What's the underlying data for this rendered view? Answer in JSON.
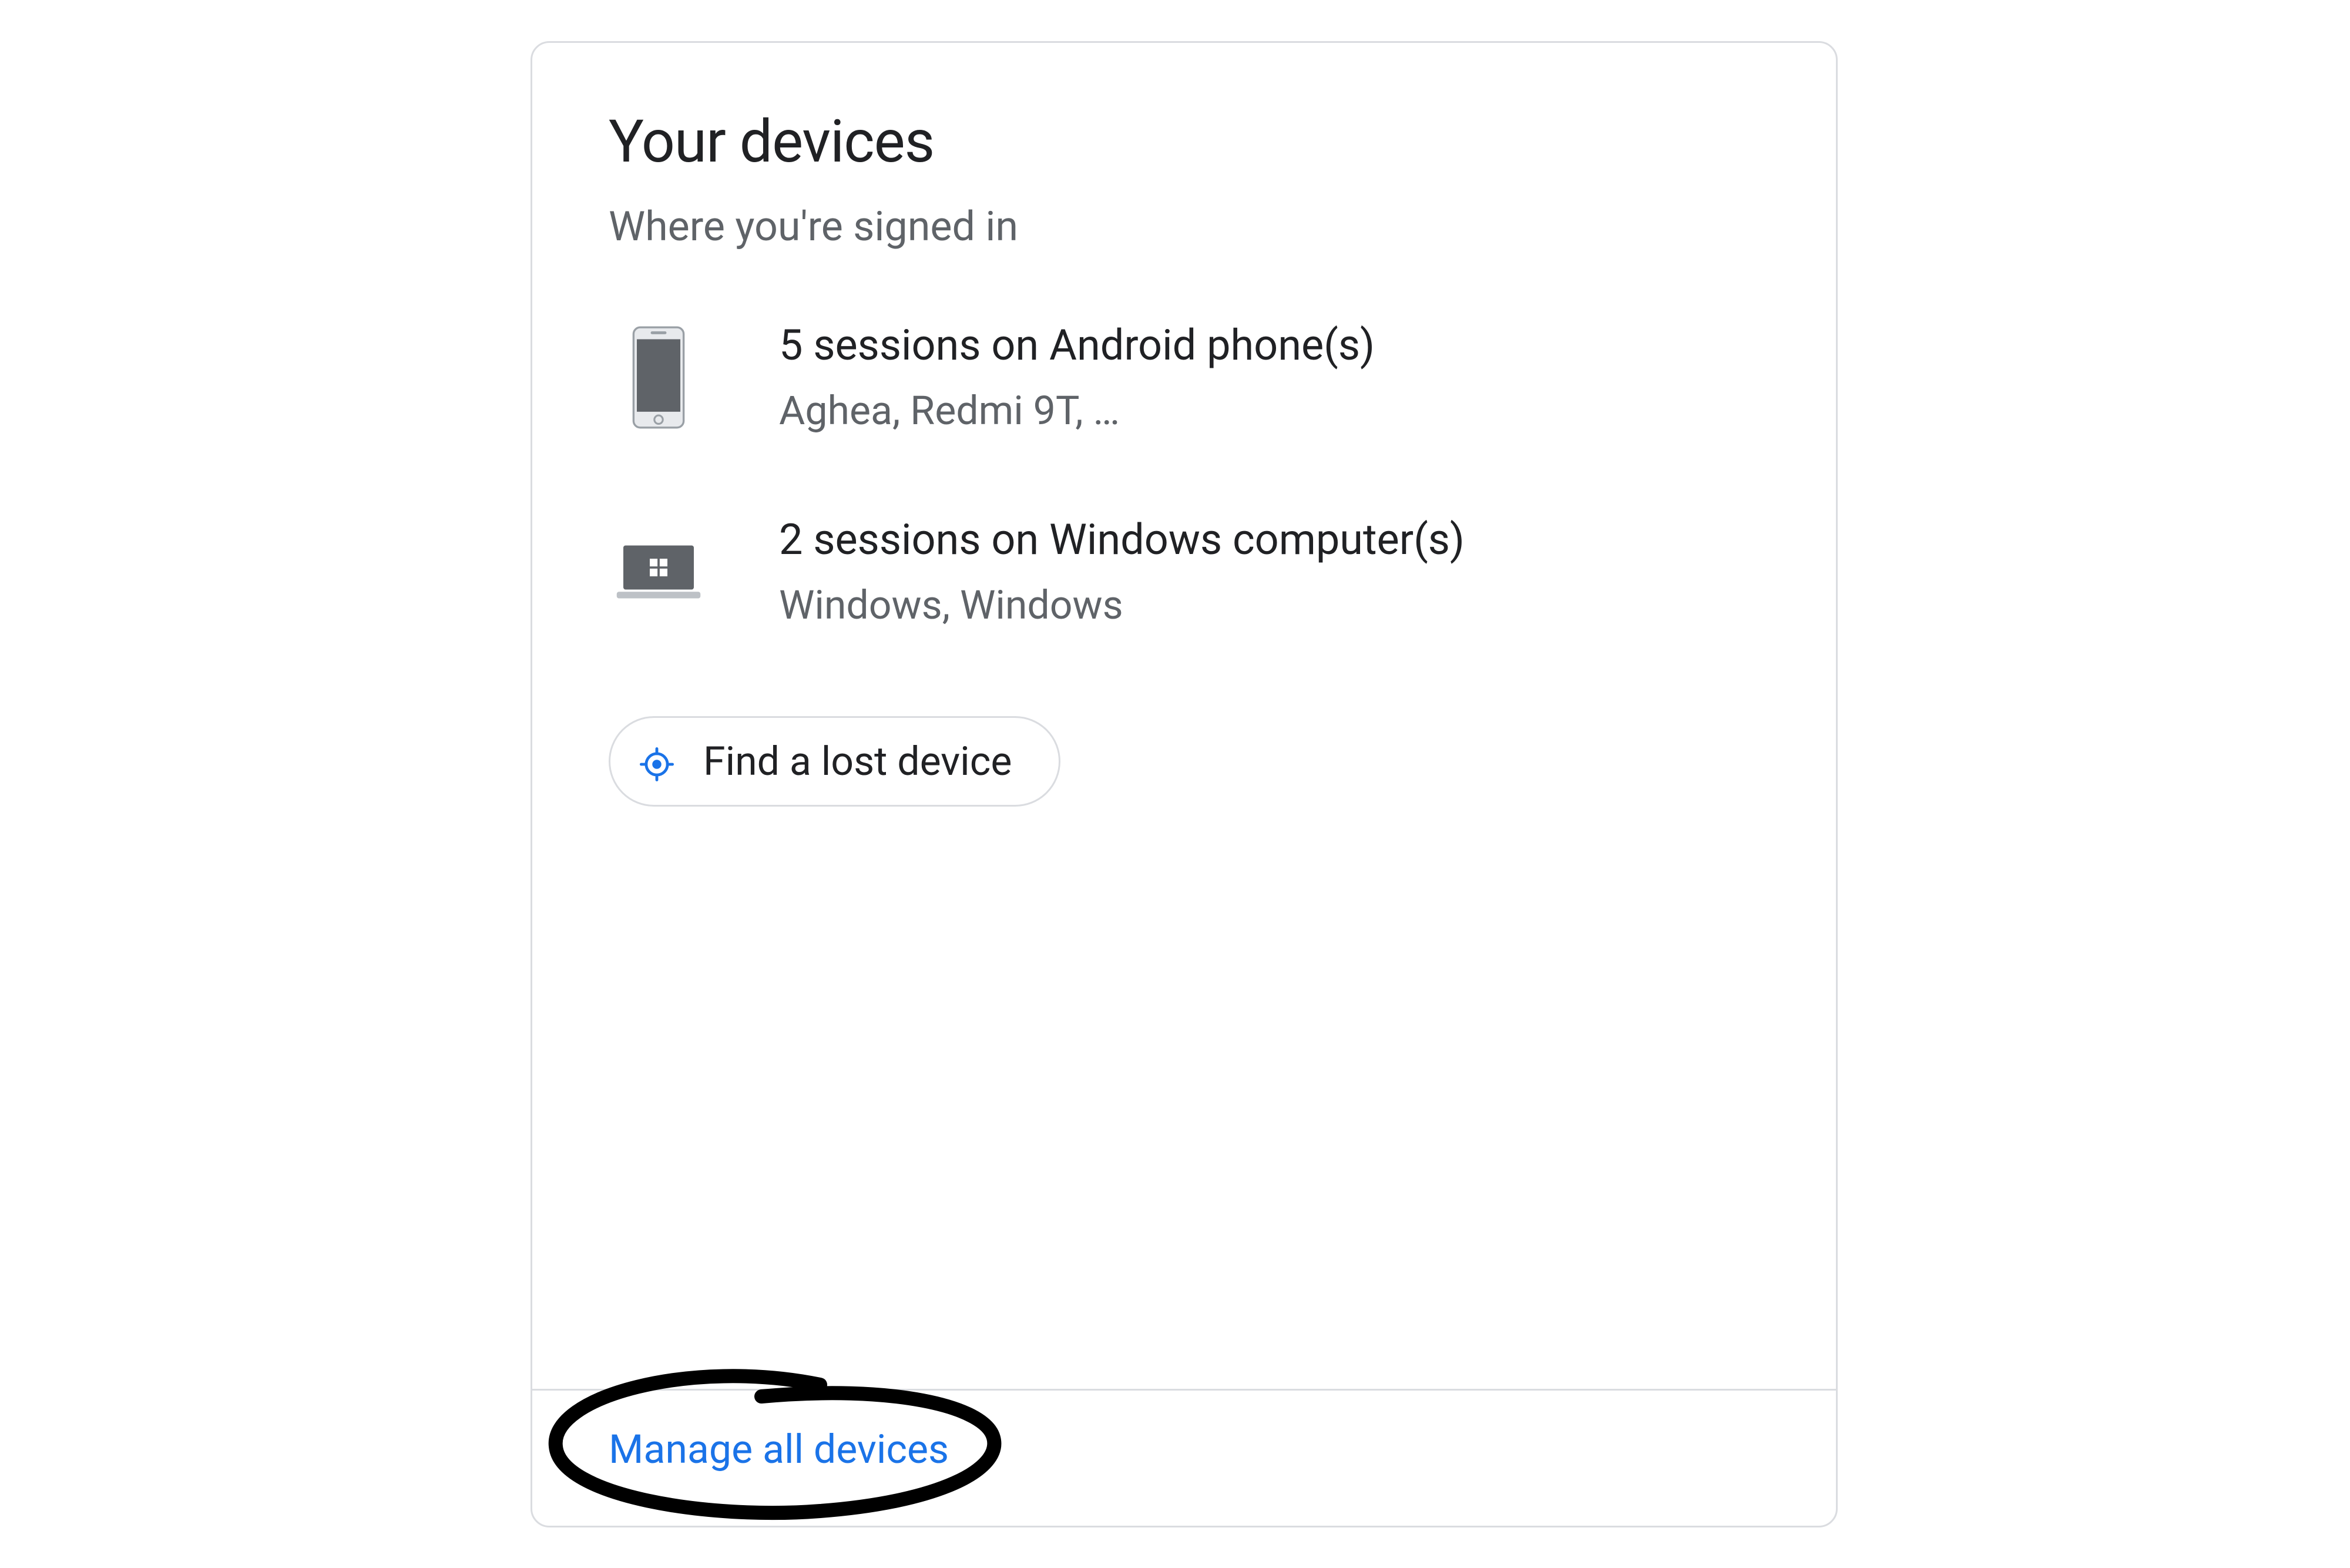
{
  "card": {
    "title": "Your devices",
    "subtitle": "Where you're signed in",
    "devices": [
      {
        "title": "5 sessions on Android phone(s)",
        "detail": "Aghea, Redmi 9T, …"
      },
      {
        "title": "2 sessions on Windows computer(s)",
        "detail": "Windows, Windows"
      }
    ],
    "find_lost_label": "Find a lost device",
    "manage_link": "Manage all devices"
  }
}
